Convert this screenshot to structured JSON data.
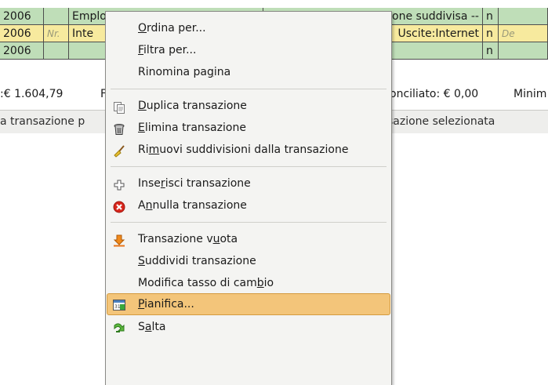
{
  "register": {
    "rows": [
      {
        "date": "2006",
        "num": "",
        "desc": "Employers R Us",
        "account": "-- Transazione suddivisa --",
        "r": "n",
        "amount": ""
      },
      {
        "date": "2006",
        "num": "Nr.",
        "desc": "Inte",
        "account": "Uscite:Internet",
        "r": "n",
        "amount": "De"
      },
      {
        "date": "2006",
        "num": "",
        "desc": "",
        "account": "",
        "r": "n",
        "amount": ""
      }
    ]
  },
  "summary": {
    "present": ":€ 1.604,79",
    "f": "F",
    "reconciled": "onciliato: € 0,00",
    "minimum": "Minim"
  },
  "statusbar": {
    "left": "a transazione p",
    "right": "sazione selezionata"
  },
  "menu": {
    "items": [
      {
        "pre": "",
        "u": "O",
        "post": "rdina per...",
        "icon": ""
      },
      {
        "pre": "",
        "u": "F",
        "post": "iltra per...",
        "icon": ""
      },
      {
        "pre": "Rinomina pa",
        "u": "g",
        "post": "ina",
        "icon": ""
      },
      {
        "pre": "",
        "u": "D",
        "post": "uplica transazione",
        "icon": "duplicate-icon"
      },
      {
        "pre": "",
        "u": "E",
        "post": "limina transazione",
        "icon": "trash-icon"
      },
      {
        "pre": "Ri",
        "u": "m",
        "post": "uovi suddivisioni dalla transazione",
        "icon": "broom-icon"
      },
      {
        "pre": "Inse",
        "u": "r",
        "post": "isci transazione",
        "icon": "plus-icon"
      },
      {
        "pre": "A",
        "u": "n",
        "post": "nulla transazione",
        "icon": "cancel-icon"
      },
      {
        "pre": "Transazione v",
        "u": "u",
        "post": "ota",
        "icon": "arrow-down-icon"
      },
      {
        "pre": "",
        "u": "S",
        "post": "uddividi transazione",
        "icon": ""
      },
      {
        "pre": "Modifica tasso di cam",
        "u": "b",
        "post": "io",
        "icon": ""
      },
      {
        "pre": "",
        "u": "P",
        "post": "ianifica...",
        "icon": "calendar-icon"
      },
      {
        "pre": "S",
        "u": "a",
        "post": "lta",
        "icon": "jump-icon"
      }
    ]
  },
  "colors": {
    "row_green": "#bfdeb8",
    "row_yellow": "#f7ea9e",
    "menu_hover": "#f3c57a"
  }
}
